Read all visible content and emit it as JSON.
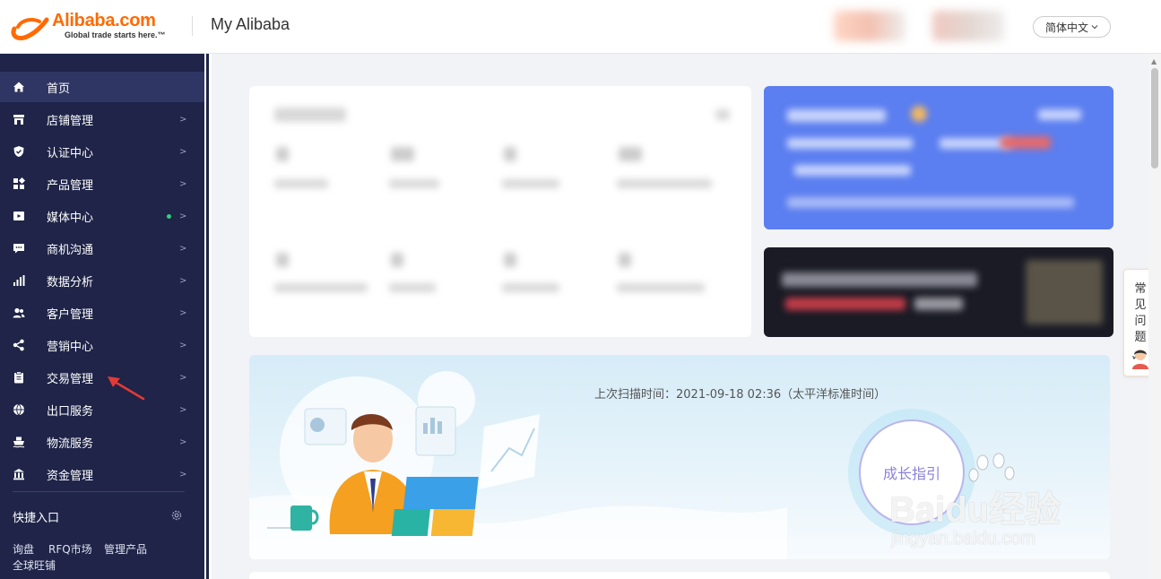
{
  "header": {
    "logo_text": "Alibaba.com",
    "logo_tagline": "Global trade starts here.™",
    "title": "My Alibaba",
    "language": "简体中文",
    "brand_color": "#ff6a00"
  },
  "sidebar": {
    "items": [
      {
        "label": "首页",
        "icon": "home-icon",
        "active": true
      },
      {
        "label": "店铺管理",
        "icon": "store-icon",
        "arrow": ">"
      },
      {
        "label": "认证中心",
        "icon": "shield-icon",
        "arrow": ">"
      },
      {
        "label": "产品管理",
        "icon": "grid-icon",
        "arrow": ">"
      },
      {
        "label": "媒体中心",
        "icon": "media-icon",
        "arrow": ">",
        "badge": "green-dot"
      },
      {
        "label": "商机沟通",
        "icon": "chat-icon",
        "arrow": ">"
      },
      {
        "label": "数据分析",
        "icon": "bar-chart-icon",
        "arrow": ">"
      },
      {
        "label": "客户管理",
        "icon": "users-icon",
        "arrow": ">"
      },
      {
        "label": "营销中心",
        "icon": "share-icon",
        "arrow": ">"
      },
      {
        "label": "交易管理",
        "icon": "clipboard-icon",
        "arrow": ">"
      },
      {
        "label": "出口服务",
        "icon": "globe-icon",
        "arrow": ">"
      },
      {
        "label": "物流服务",
        "icon": "ship-icon",
        "arrow": ">"
      },
      {
        "label": "资金管理",
        "icon": "bank-icon",
        "arrow": ">"
      }
    ],
    "quick_title": "快捷入口",
    "quick_links": [
      "询盘",
      "RFQ市场",
      "管理产品",
      "全球旺铺"
    ],
    "bg_color": "#1f2448",
    "active_color": "#303663"
  },
  "growth": {
    "scan_time": "上次扫描时间：2021-09-18 02:36（太平洋标准时间）",
    "button_label": "成长指引"
  },
  "faq": {
    "chars": [
      "常",
      "见",
      "问",
      "题"
    ]
  },
  "watermark": {
    "main": "Baidu经验",
    "sub": "jingyan.baidu.com"
  }
}
